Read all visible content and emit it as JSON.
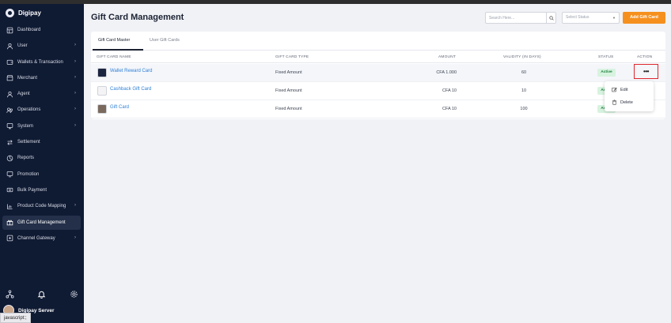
{
  "brand": {
    "name": "Digipay"
  },
  "sidebar": {
    "items": [
      {
        "label": "Dashboard",
        "icon": "dashboard-icon",
        "chevron": false
      },
      {
        "label": "User",
        "icon": "user-icon",
        "chevron": true
      },
      {
        "label": "Wallets & Transaction",
        "icon": "wallet-icon",
        "chevron": true
      },
      {
        "label": "Merchant",
        "icon": "merchant-icon",
        "chevron": true
      },
      {
        "label": "Agent",
        "icon": "agent-icon",
        "chevron": true
      },
      {
        "label": "Operations",
        "icon": "operations-icon",
        "chevron": true
      },
      {
        "label": "System",
        "icon": "system-icon",
        "chevron": true
      },
      {
        "label": "Settlement",
        "icon": "settlement-icon",
        "chevron": false
      },
      {
        "label": "Reports",
        "icon": "reports-icon",
        "chevron": false
      },
      {
        "label": "Promotion",
        "icon": "promotion-icon",
        "chevron": false
      },
      {
        "label": "Bulk Payment",
        "icon": "bulk-payment-icon",
        "chevron": false
      },
      {
        "label": "Product Code Mapping",
        "icon": "product-code-icon",
        "chevron": true
      },
      {
        "label": "Gift Card Management",
        "icon": "gift-icon",
        "chevron": false,
        "active": true
      },
      {
        "label": "Channel Gateway",
        "icon": "gateway-icon",
        "chevron": true
      }
    ],
    "chevron_glyph": "›",
    "user_name": "Digipay Server",
    "status_tip": "javascript:;"
  },
  "header": {
    "title": "Gift Card Management",
    "search_placeholder": "Search Here...",
    "status_select": "Select Status",
    "add_button": "Add Gift Card"
  },
  "tabs": [
    {
      "label": "Gift Card Master",
      "active": true
    },
    {
      "label": "User Gift Cards",
      "active": false
    }
  ],
  "table": {
    "headers": {
      "name": "GIFT CARD NAME",
      "type": "GIFT CARD TYPE",
      "amount": "AMOUNT",
      "validity": "VALIDITY (IN DAYS)",
      "status": "STATUS",
      "action": "ACTION"
    },
    "rows": [
      {
        "name": "Wallet Reward Card",
        "type": "Fixed Amount",
        "amount": "CFA 1.000",
        "validity": "60",
        "status": "Active",
        "thumb_color": "#1c2540"
      },
      {
        "name": "Cashback Gift Card",
        "type": "Fixed Amount",
        "amount": "CFA 10",
        "validity": "10",
        "status": "Active",
        "thumb_color": "#f4f4f6"
      },
      {
        "name": "Gift Card",
        "type": "Fixed Amount",
        "amount": "CFA 10",
        "validity": "100",
        "status": "Active",
        "thumb_color": "#7a6a5e"
      }
    ],
    "action_glyph": "•••"
  },
  "menu": {
    "edit": "Edit",
    "delete": "Delete"
  },
  "colors": {
    "sidebar_bg": "#0f1a33",
    "accent": "#f5901f",
    "link": "#2f7fd6",
    "active_badge_bg": "#d7f3df",
    "active_badge_text": "#1b7f3b",
    "highlight_border": "#e0262f"
  }
}
